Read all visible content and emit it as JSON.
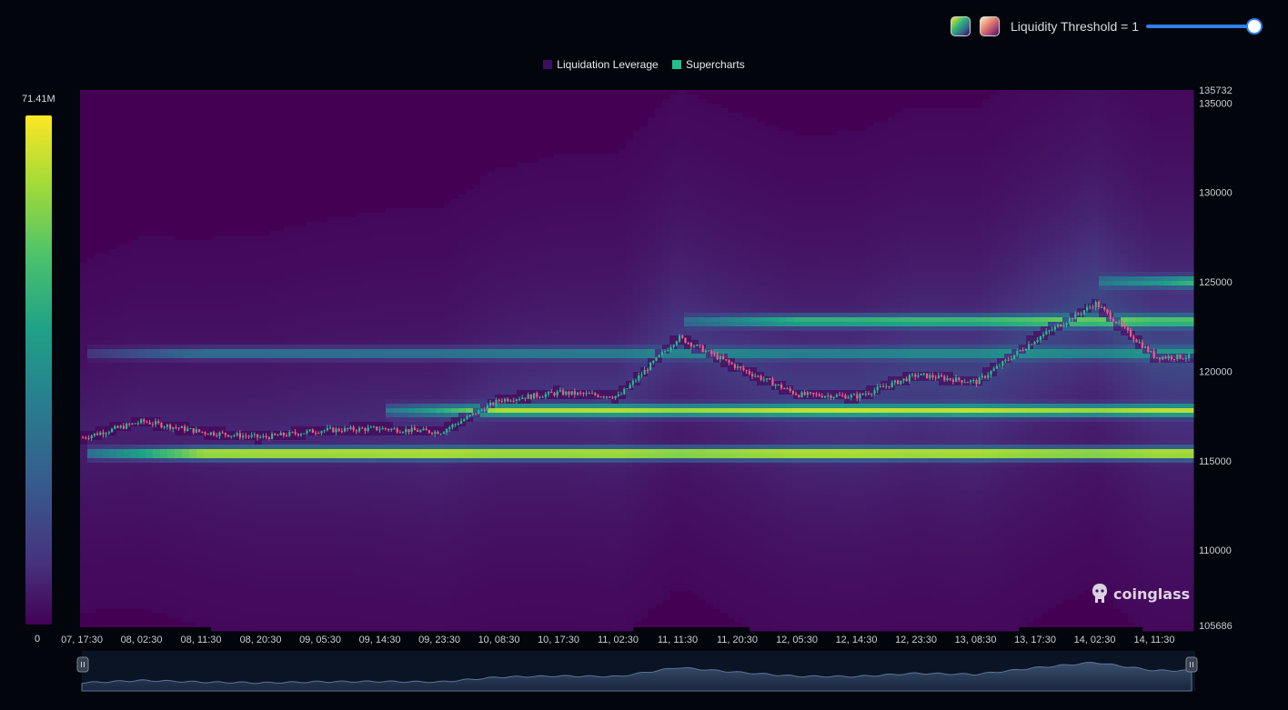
{
  "toolbar": {
    "threshold_label": "Liquidity Threshold = 1",
    "threshold_value": 1,
    "accent": "#2f80ed",
    "palette_icons": [
      "viridis-palette-icon",
      "warm-palette-icon"
    ]
  },
  "legend": {
    "items": [
      {
        "label": "Liquidation Leverage",
        "color": "#3b0f5c"
      },
      {
        "label": "Supercharts",
        "color": "#21c08b"
      }
    ]
  },
  "colorbar": {
    "max_label": "71.41M",
    "min_label": "0"
  },
  "watermark": {
    "text": "coinglass",
    "icon": "coinglass-logo-icon"
  },
  "chart_data": {
    "type": "heatmap",
    "title": "",
    "xlabel": "",
    "ylabel": "",
    "ylim": [
      105686,
      135732
    ],
    "y_ticks": [
      "135732",
      "135000",
      "130000",
      "125000",
      "120000",
      "115000",
      "110000",
      "105686"
    ],
    "x_ticks": [
      "07, 17:30",
      "08, 02:30",
      "08, 11:30",
      "08, 20:30",
      "09, 05:30",
      "09, 14:30",
      "09, 23:30",
      "10, 08:30",
      "10, 17:30",
      "11, 02:30",
      "11, 11:30",
      "11, 20:30",
      "12, 05:30",
      "12, 14:30",
      "12, 23:30",
      "13, 08:30",
      "13, 17:30",
      "14, 02:30",
      "14, 11:30"
    ],
    "colorscale": [
      "#440154",
      "#46327e",
      "#365c8d",
      "#277f8e",
      "#1fa187",
      "#4ac16d",
      "#a0da39",
      "#fde725"
    ],
    "liquidity_bands": [
      {
        "price": 115400,
        "intensity": 0.9,
        "from_tick": 0
      },
      {
        "price": 117800,
        "intensity": 0.75,
        "from_tick": 5
      },
      {
        "price": 122800,
        "intensity": 0.6,
        "from_tick": 10
      },
      {
        "price": 125000,
        "intensity": 0.65,
        "from_tick": 17
      },
      {
        "price": 121000,
        "intensity": 0.35,
        "from_tick": 0
      }
    ],
    "price_series": {
      "name": "Supercharts",
      "close_by_tick": [
        116300,
        117200,
        116600,
        116300,
        116700,
        116800,
        116600,
        118400,
        118800,
        118600,
        121900,
        120200,
        118700,
        118600,
        119800,
        119400,
        121800,
        123800,
        120800
      ]
    },
    "grid": false,
    "legend_position": "top-center"
  }
}
